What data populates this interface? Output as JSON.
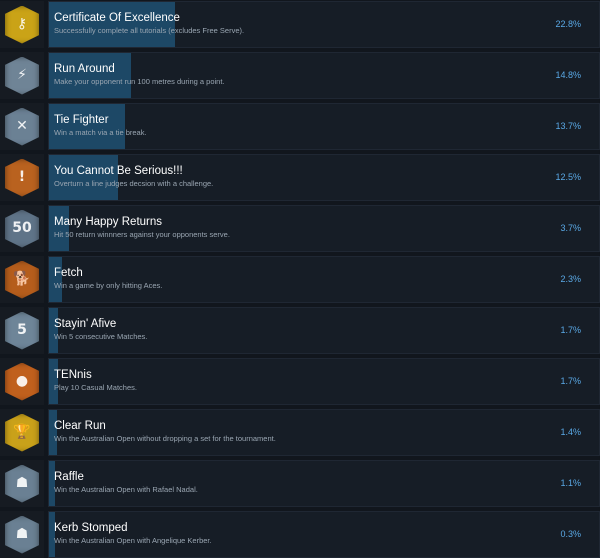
{
  "colors": {
    "background": "#11161d",
    "panel": "#161d26",
    "progress_bar": "#1d4866",
    "title_text": "#ffffff",
    "description_text": "#9aa6b2",
    "percent_text": "#5aa9e6"
  },
  "achievements": [
    {
      "title": "Certificate Of Excellence",
      "description": "Successfully complete all tutorials (excludes Free Serve).",
      "percent": "22.8%",
      "icon": "certificate-icon",
      "icon_color": "#caa317",
      "glyph": "⚷"
    },
    {
      "title": "Run Around",
      "description": "Make your opponent run 100 metres during a point.",
      "percent": "14.8%",
      "icon": "running-player-icon",
      "icon_color": "#6f8496",
      "glyph": "⚡"
    },
    {
      "title": "Tie Fighter",
      "description": "Win a match via a tie break.",
      "percent": "13.7%",
      "icon": "tie-fighter-icon",
      "icon_color": "#6b8194",
      "glyph": "✕"
    },
    {
      "title": "You Cannot Be Serious!!!",
      "description": "Overturn a line judges decsion with a challenge.",
      "percent": "12.5%",
      "icon": "angry-player-icon",
      "icon_color": "#b9621f",
      "glyph": "!"
    },
    {
      "title": "Many Happy Returns",
      "description": "Hit 50 return winnners against your opponents serve.",
      "percent": "3.7%",
      "icon": "fifty-returns-icon",
      "icon_color": "#5f7488",
      "glyph": "50"
    },
    {
      "title": "Fetch",
      "description": "Win a game by only hitting Aces.",
      "percent": "2.3%",
      "icon": "dog-fetch-icon",
      "icon_color": "#b55d1c",
      "glyph": "🐕"
    },
    {
      "title": "Stayin' Afive",
      "description": "Win 5 consecutive Matches.",
      "percent": "1.7%",
      "icon": "five-wins-icon",
      "icon_color": "#6e8598",
      "glyph": "5"
    },
    {
      "title": "TENnis",
      "description": "Play 10 Casual Matches.",
      "percent": "1.7%",
      "icon": "tennis-ball-icon",
      "icon_color": "#c0601d",
      "glyph": "●"
    },
    {
      "title": "Clear Run",
      "description": "Win the Australian Open without dropping a set for the tournament.",
      "percent": "1.4%",
      "icon": "trophy-icon",
      "icon_color": "#c9a11a",
      "glyph": "🏆"
    },
    {
      "title": "Raffle",
      "description": "Win the Australian Open with Rafael Nadal.",
      "percent": "1.1%",
      "icon": "nadal-player-icon",
      "icon_color": "#6a8093",
      "glyph": "☗"
    },
    {
      "title": "Kerb Stomped",
      "description": "Win the Australian Open with Angelique Kerber.",
      "percent": "0.3%",
      "icon": "kerber-player-icon",
      "icon_color": "#6a8093",
      "glyph": "☗"
    }
  ]
}
